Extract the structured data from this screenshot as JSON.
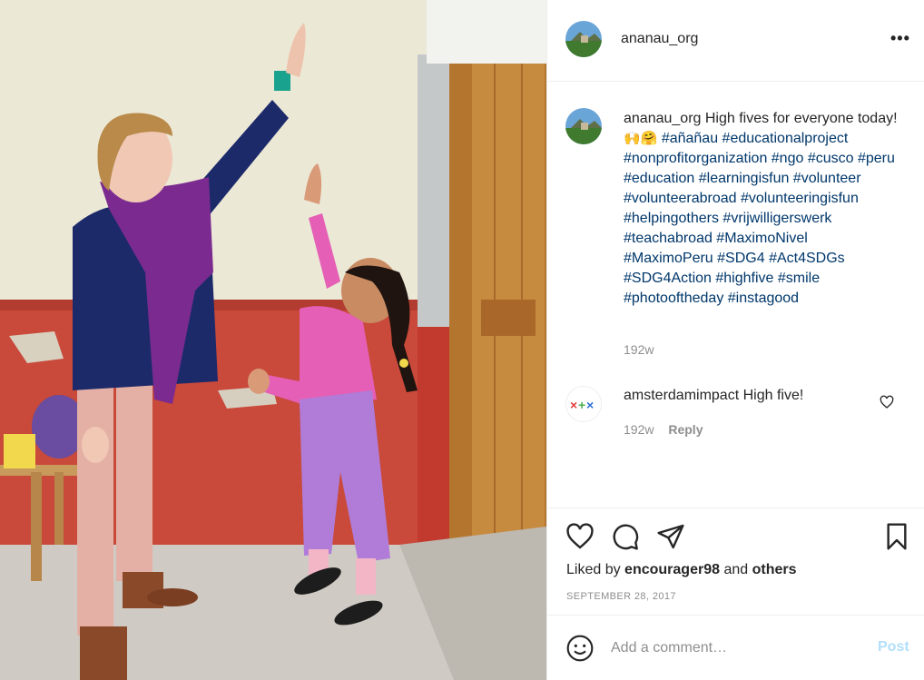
{
  "header": {
    "username": "ananau_org",
    "more_label": "•••"
  },
  "caption": {
    "username": "ananau_org",
    "text": "High fives for everyone today!",
    "emojis": "🙌🤗",
    "hashtags": "#añañau #educationalproject #nonprofitorganization #ngo #cusco #peru #education #learningisfun #volunteer #volunteerabroad #volunteeringisfun #helpingothers #vrijwilligerswerk #teachabroad #MaximoNivel #MaximoPeru #SDG4 #Act4SDGs #SDG4Action #highfive #smile #photooftheday #instagood",
    "timestamp": "192w"
  },
  "comment": {
    "username": "amsterdamimpact",
    "text": "High five!",
    "timestamp": "192w",
    "reply_label": "Reply"
  },
  "actions": {
    "icons": [
      "heart-icon",
      "comment-icon",
      "share-icon",
      "bookmark-icon"
    ]
  },
  "likes": {
    "prefix": "Liked by",
    "user": "encourager98",
    "conj": "and",
    "others": "others"
  },
  "date": "SEPTEMBER 28, 2017",
  "add_comment": {
    "placeholder": "Add a comment…",
    "post_label": "Post"
  },
  "colors": {
    "link_blue": "#00376b",
    "post_disabled": "#b2dffc",
    "muted": "#8e8e8e",
    "text": "#262626"
  }
}
